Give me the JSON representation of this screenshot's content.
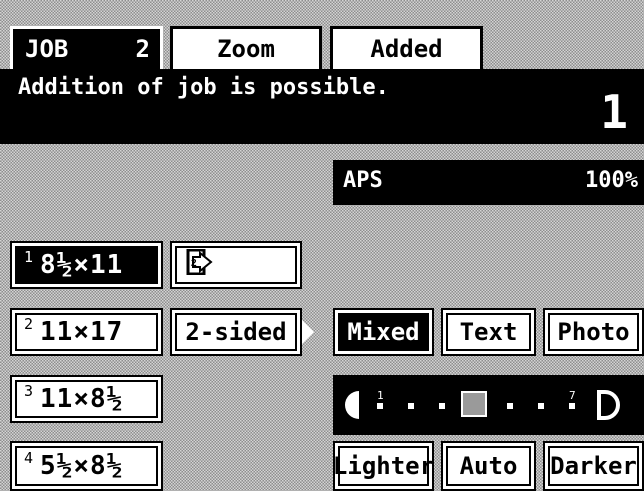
{
  "tabs": {
    "job_label": "JOB",
    "job_count": "2",
    "zoom_label": "Zoom",
    "added_label": "Added"
  },
  "message": {
    "text": "Addition of job is possible.",
    "copies": "1"
  },
  "status": {
    "paper_mode": "APS",
    "zoom_percent": "100%"
  },
  "paper_sizes": [
    {
      "index": "1",
      "label": "8½×11",
      "selected": true
    },
    {
      "index": "2",
      "label": "11×17",
      "selected": false
    },
    {
      "index": "3",
      "label": "11×8½",
      "selected": false
    },
    {
      "index": "4",
      "label": "5½×8½",
      "selected": false
    }
  ],
  "duplex": {
    "label": "2-sided",
    "icon": "original-document-icon"
  },
  "image_modes": [
    {
      "label": "Mixed",
      "selected": true
    },
    {
      "label": "Text",
      "selected": false
    },
    {
      "label": "Photo",
      "selected": false
    }
  ],
  "density": {
    "level": 4,
    "min_label": "1",
    "max_label": "7",
    "lighter_label": "Lighter",
    "auto_label": "Auto",
    "darker_label": "Darker"
  },
  "colors": {
    "background": "#b4b4b4",
    "bar": "#000000",
    "button": "#ffffff",
    "density_marker": "#9a9a9a"
  }
}
